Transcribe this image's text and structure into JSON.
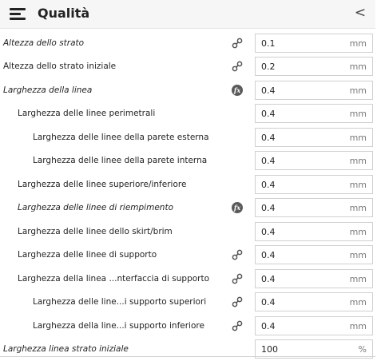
{
  "header": {
    "title": "Qualità",
    "collapse_glyph": "<",
    "menu_icon": "menu-icon"
  },
  "rows": [
    {
      "label": "Altezza dello strato",
      "value": "0.1",
      "unit": "mm",
      "icon": "link-icon"
    },
    {
      "label": "Altezza dello strato iniziale",
      "value": "0.2",
      "unit": "mm",
      "icon": "link-icon"
    },
    {
      "label": "Larghezza della linea",
      "value": "0.4",
      "unit": "mm",
      "icon": "function-icon",
      "icon_text": "fx"
    },
    {
      "label": "Larghezza delle linee perimetrali",
      "value": "0.4",
      "unit": "mm"
    },
    {
      "label": "Larghezza delle linee della parete esterna",
      "value": "0.4",
      "unit": "mm"
    },
    {
      "label": "Larghezza delle linee della parete interna",
      "value": "0.4",
      "unit": "mm"
    },
    {
      "label": "Larghezza delle linee superiore/inferiore",
      "value": "0.4",
      "unit": "mm"
    },
    {
      "label": "Larghezza delle linee di riempimento",
      "value": "0.4",
      "unit": "mm",
      "icon": "function-icon",
      "icon_text": "fx"
    },
    {
      "label": "Larghezza delle linee dello skirt/brim",
      "value": "0.4",
      "unit": "mm"
    },
    {
      "label": "Larghezza delle linee di supporto",
      "value": "0.4",
      "unit": "mm",
      "icon": "link-icon"
    },
    {
      "label": "Larghezza della linea ...nterfaccia di supporto",
      "value": "0.4",
      "unit": "mm",
      "icon": "link-icon"
    },
    {
      "label": "Larghezza delle line...i supporto superiori",
      "value": "0.4",
      "unit": "mm",
      "icon": "link-icon"
    },
    {
      "label": "Larghezza della line...i supporto inferiore",
      "value": "0.4",
      "unit": "mm",
      "icon": "link-icon"
    },
    {
      "label": "Larghezza linea strato iniziale",
      "value": "100",
      "unit": "%"
    }
  ]
}
